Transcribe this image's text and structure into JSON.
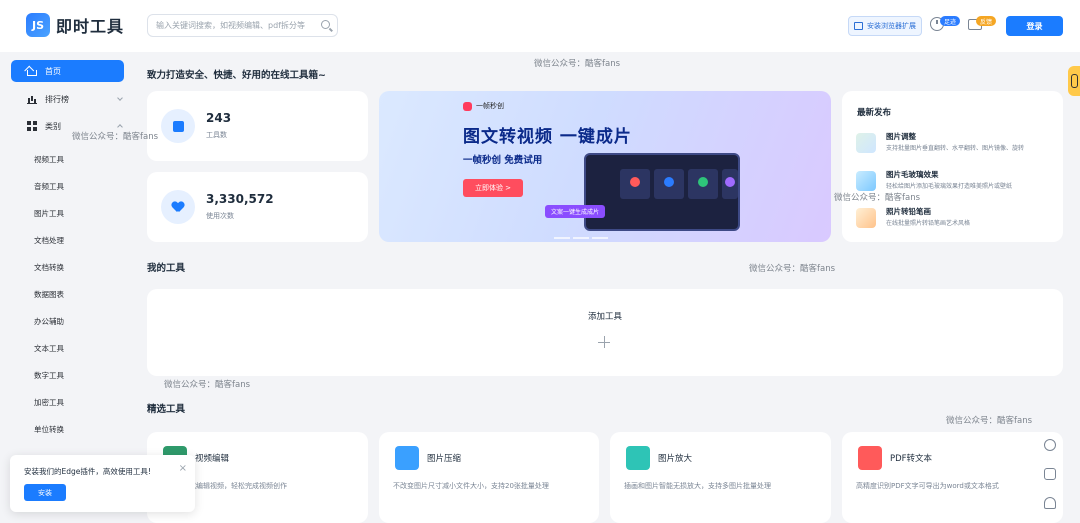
{
  "header": {
    "logo_mark": "JS",
    "logo_text": "即时工具",
    "search_placeholder": "输入关键词搜索，如视频编辑、pdf拆分等",
    "install_ext": "安装浏览器扩展",
    "history_badge": "足迹",
    "feedback_badge": "反馈",
    "login": "登录"
  },
  "sidebar": {
    "home": "首页",
    "rank": "排行榜",
    "category": "类别",
    "sub_items": [
      "视频工具",
      "音频工具",
      "图片工具",
      "文档处理",
      "文档转换",
      "数据图表",
      "办公辅助",
      "文本工具",
      "数字工具",
      "加密工具",
      "单位转换"
    ]
  },
  "slogan": "致力打造安全、快捷、好用的在线工具箱~",
  "stats": [
    {
      "value": "243",
      "label": "工具数"
    },
    {
      "value": "3,330,572",
      "label": "使用次数"
    }
  ],
  "banner": {
    "brand": "一帧秒创",
    "headline": "图文转视频  一键成片",
    "sub": "一帧秒创 免费试用",
    "cta": "立即体验  >",
    "tag": "文案一键生成成片"
  },
  "news": {
    "title": "最新发布",
    "items": [
      {
        "name": "图片调整",
        "desc": "支持批量图片垂直翻转、水平翻转、图片镜像、旋转"
      },
      {
        "name": "图片毛玻璃效果",
        "desc": "轻松给图片添加毛玻璃效果打造唯美照片或壁纸"
      },
      {
        "name": "照片转铅笔画",
        "desc": "在线批量照片转铅笔画艺术风格"
      }
    ]
  },
  "my_tools": {
    "title": "我的工具",
    "add": "添加工具"
  },
  "featured": {
    "title": "精选工具",
    "items": [
      {
        "name": "视频编辑",
        "desc": "在线截剪或编辑视频，轻松完成视频创作",
        "color": "#2f9a6b"
      },
      {
        "name": "图片压缩",
        "desc": "不改变图片尺寸减小文件大小，支持20张批量处理",
        "color": "#3aa0ff"
      },
      {
        "name": "图片放大",
        "desc": "插画和图片智能无损放大，支持多图片批量处理",
        "color": "#2ec4b6"
      },
      {
        "name": "PDF转文本",
        "desc": "高精度识别PDF文字可导出为word或文本格式",
        "color": "#ff5a5a"
      }
    ]
  },
  "watermark": "微信公众号：酷客fans",
  "toast": {
    "text": "安装我们的Edge插件，高效使用工具!",
    "close": "×",
    "button": "安装"
  },
  "colors": {
    "primary": "#1b7cff",
    "background": "#f3f4f7"
  }
}
